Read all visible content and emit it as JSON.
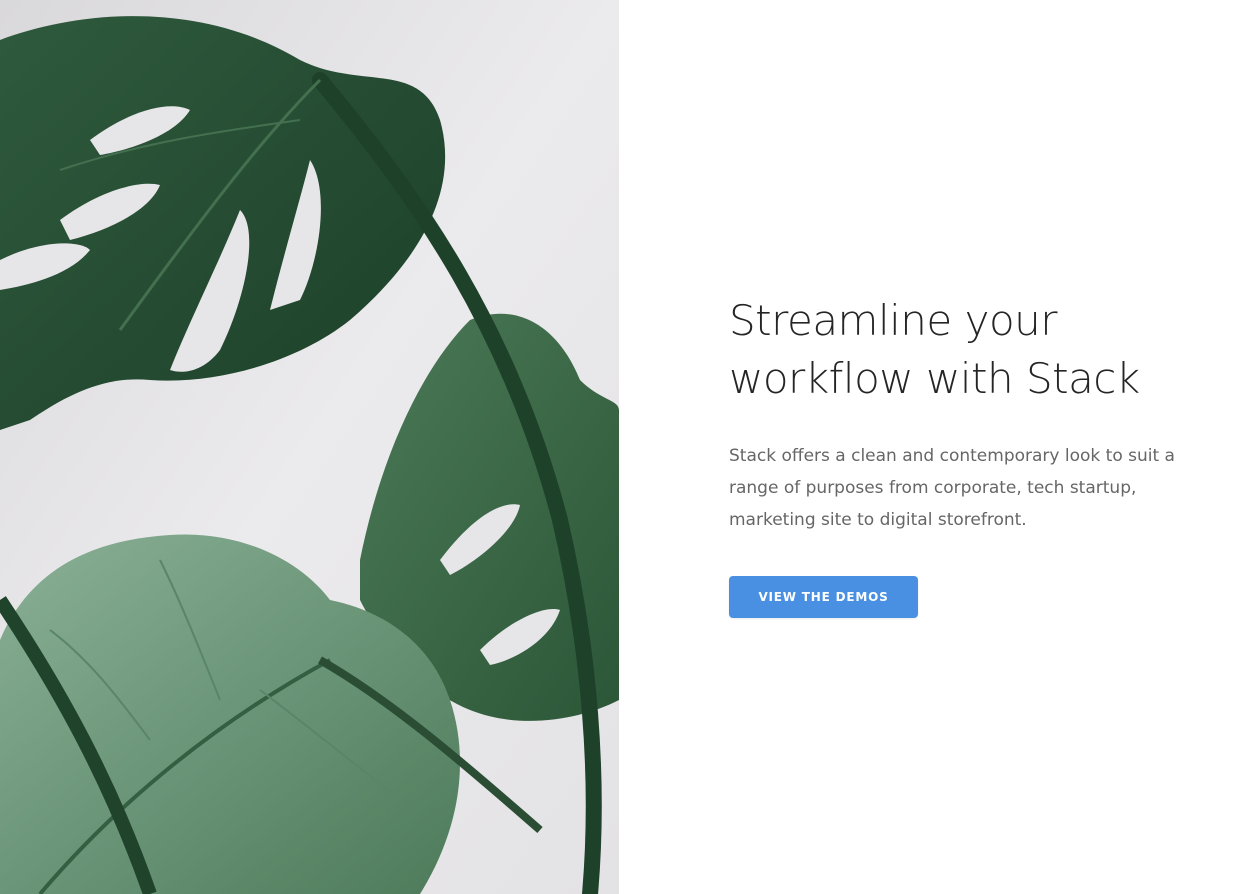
{
  "hero": {
    "image": {
      "description_icon": "monstera-leaf-photo",
      "background_color": "#e9e8ea"
    },
    "headline": "Streamline your workflow with Stack",
    "lead": "Stack offers a clean and contemporary look to suit a range of purposes from corporate, tech startup, marketing site to digital storefront.",
    "cta_label": "VIEW THE DEMOS",
    "accent_color": "#4a90e2"
  }
}
